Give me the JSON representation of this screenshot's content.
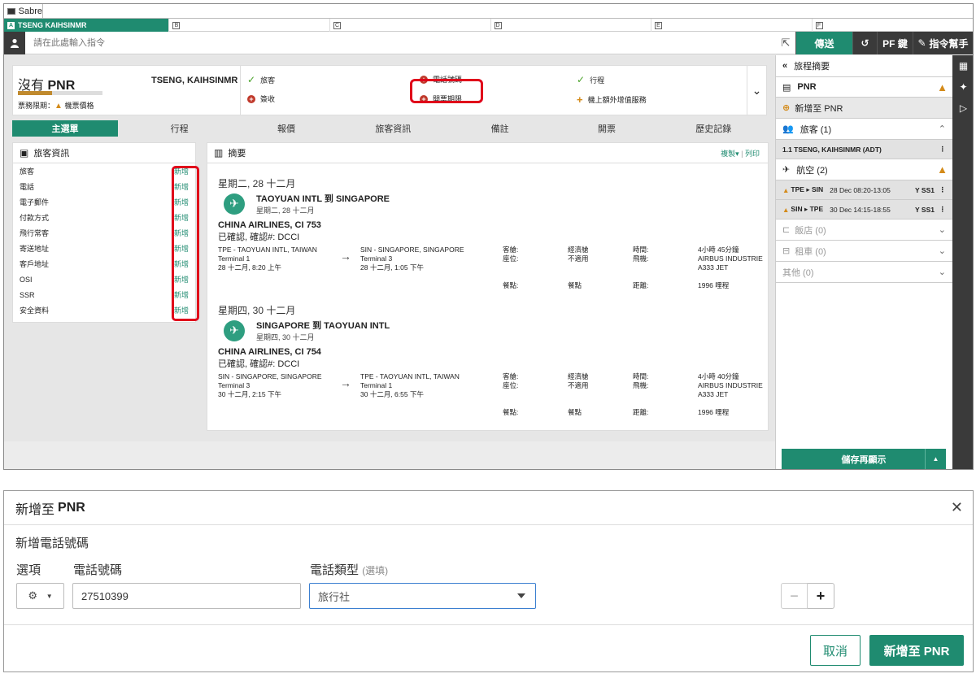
{
  "window": {
    "title": "Sabre"
  },
  "areas": [
    {
      "letter": "A",
      "label": "TSENG KAIHSINMR"
    },
    {
      "letter": "B",
      "label": ""
    },
    {
      "letter": "C",
      "label": ""
    },
    {
      "letter": "D",
      "label": ""
    },
    {
      "letter": "E",
      "label": ""
    },
    {
      "letter": "F",
      "label": ""
    }
  ],
  "command": {
    "placeholder": "請在此處輸入指令",
    "send": "傳送",
    "pf": "PF 鍵",
    "helper": "指令幫手"
  },
  "pnr": {
    "title_prefix": "沒有",
    "title": "PNR",
    "passenger": "TSENG, KAIHSINMR",
    "ticket_limit": "票務限期：",
    "ticket_limit_value": "機票價格",
    "progress": 0.4,
    "checks": [
      {
        "status": "ok",
        "label": "旅客"
      },
      {
        "status": "missing",
        "label": "電話號碼"
      },
      {
        "status": "ok",
        "label": "行程"
      },
      {
        "status": "missing",
        "label": "簽收"
      },
      {
        "status": "missing",
        "label": "開票期限"
      },
      {
        "status": "optional",
        "label": "機上額外增值服務"
      }
    ]
  },
  "tabs": [
    "主選單",
    "行程",
    "報價",
    "旅客資訊",
    "備註",
    "開票",
    "歷史記錄"
  ],
  "pax_info": {
    "title": "旅客資訊",
    "add_label": "新增",
    "rows": [
      "旅客",
      "電話",
      "電子郵件",
      "付款方式",
      "飛行常客",
      "寄送地址",
      "客戶地址",
      "OSI",
      "SSR",
      "安全資料"
    ]
  },
  "summary": {
    "title": "摘要",
    "copy": "複製▾",
    "separator": "|",
    "print": "列印",
    "days": [
      {
        "day": "星期二, 28 十二月",
        "route": "TAOYUAN INTL 到 SINGAPORE",
        "route_date": "星期二, 28 十二月",
        "flight": "CHINA AIRLINES, CI 753",
        "status": "已確認, 確認#: DCCI",
        "from_name": "TPE - TAOYUAN INTL, TAIWAN",
        "from_term": "Terminal 1",
        "from_time": "28 十二月, 8:20 上午",
        "to_name": "SIN - SINGAPORE, SINGAPORE",
        "to_term": "Terminal 3",
        "to_time": "28 十二月, 1:05 下午",
        "cabin_l": "客艙:",
        "cabin": "經濟艙",
        "seat_l": "座位:",
        "seat": "不適用",
        "meal_l": "餐點:",
        "meal": "餐點",
        "dur_l": "時間:",
        "dur": "4小時 45分鐘",
        "aircraft_l": "飛機:",
        "aircraft": "AIRBUS INDUSTRIE A333 JET",
        "dist_l": "距離:",
        "dist": "1996 哩程"
      },
      {
        "day": "星期四, 30 十二月",
        "route": "SINGAPORE 到 TAOYUAN INTL",
        "route_date": "星期四, 30 十二月",
        "flight": "CHINA AIRLINES, CI 754",
        "status": "已確認, 確認#: DCCI",
        "from_name": "SIN - SINGAPORE, SINGAPORE",
        "from_term": "Terminal 3",
        "from_time": "30 十二月, 2:15 下午",
        "to_name": "TPE - TAOYUAN INTL, TAIWAN",
        "to_term": "Terminal 1",
        "to_time": "30 十二月, 6:55 下午",
        "cabin_l": "客艙:",
        "cabin": "經濟艙",
        "seat_l": "座位:",
        "seat": "不適用",
        "meal_l": "餐點:",
        "meal": "餐點",
        "dur_l": "時間:",
        "dur": "4小時 40分鐘",
        "aircraft_l": "飛機:",
        "aircraft": "AIRBUS INDUSTRIE A333 JET",
        "dist_l": "距離:",
        "dist": "1996 哩程"
      }
    ]
  },
  "right_panel": {
    "header": "旅程摘要",
    "pnr": "PNR",
    "add_pnr": "新增至 PNR",
    "travelers": "旅客 (1)",
    "traveler1": "1.1 TSENG, KAIHSINMR (ADT)",
    "air": "航空 (2)",
    "segments": [
      {
        "route": "TPE ▸ SIN",
        "date": "28 Dec 08:20-13:05",
        "cls": "Y SS1"
      },
      {
        "route": "SIN ▸ TPE",
        "date": "30 Dec 14:15-18:55",
        "cls": "Y SS1"
      }
    ],
    "hotel": "飯店 (0)",
    "car": "租車 (0)",
    "other": "其他 (0)",
    "save": "儲存再顯示"
  },
  "modal": {
    "title_prefix": "新增至",
    "title": "PNR",
    "subtitle": "新增電話號碼",
    "opt_label": "選項",
    "phone_label": "電話號碼",
    "type_label": "電話類型",
    "type_opt": "(選填)",
    "phone_value": "27510399",
    "type_value": "旅行社",
    "minus": "−",
    "plus": "+",
    "cancel": "取消",
    "submit": "新增至 PNR"
  },
  "colors": {
    "accent": "#1f8b70",
    "dark": "#3a3a3a",
    "warn": "#d48b1a",
    "error": "#c0392b",
    "highlight": "#e0001a"
  }
}
